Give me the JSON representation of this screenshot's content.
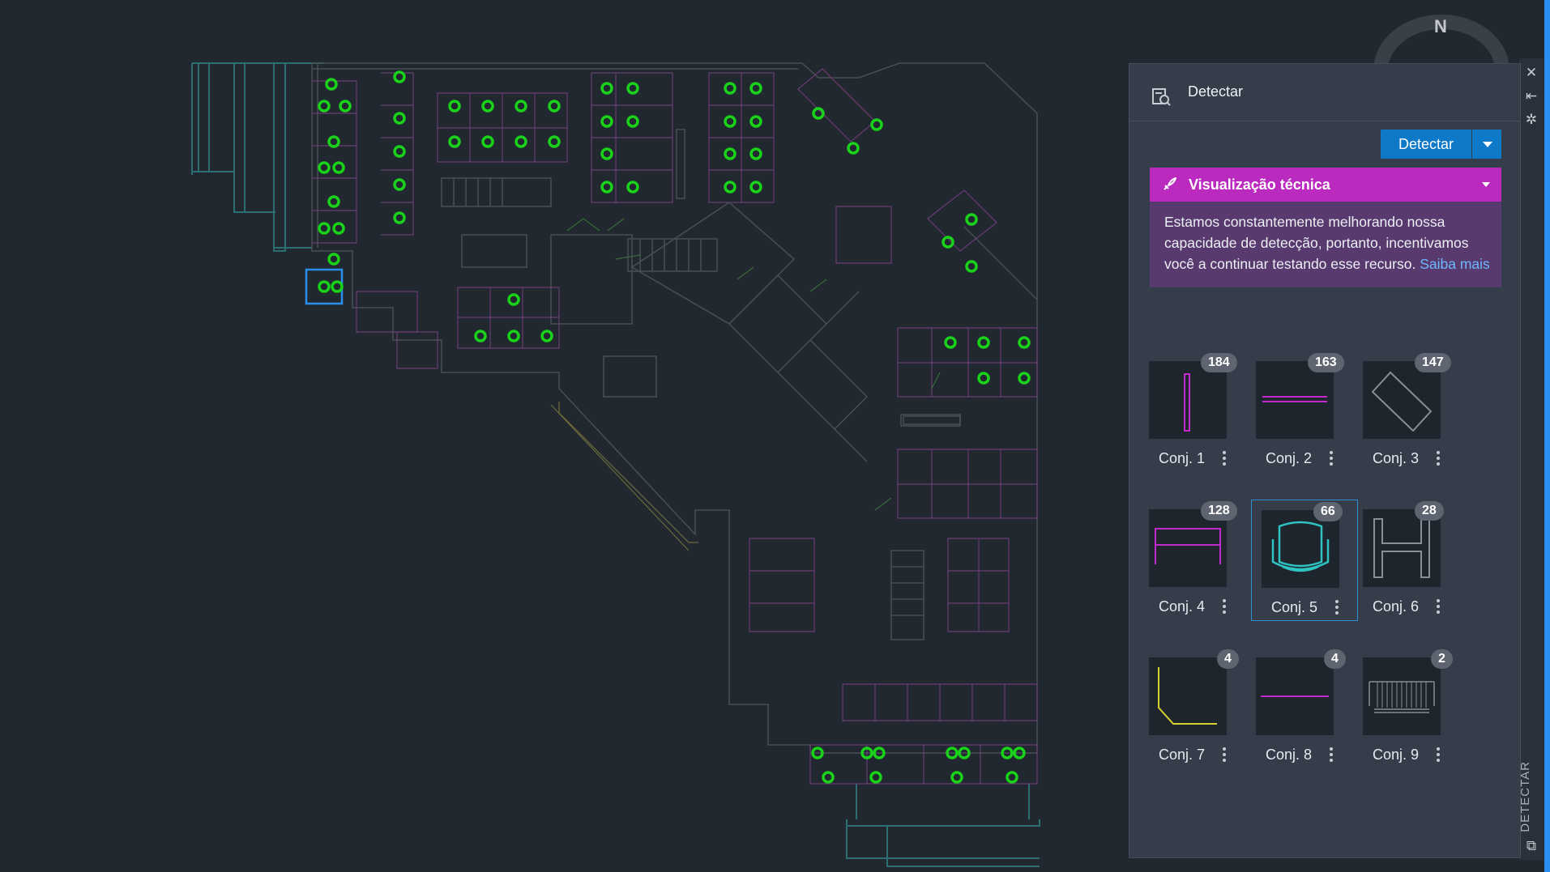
{
  "compass": {
    "label": "N"
  },
  "panel": {
    "title": "Detectar",
    "detect_button": "Detectar",
    "preview": {
      "title": "Visualização técnica",
      "body": "Estamos constantemente melhorando nossa capacidade de detecção, portanto, incentivamos você a continuar testando esse recurso.",
      "link": "Saiba mais"
    },
    "sets": [
      {
        "label": "Conj. 1",
        "count": "184",
        "icon": "vertical-line-magenta-icon"
      },
      {
        "label": "Conj. 2",
        "count": "163",
        "icon": "double-horizontal-line-magenta-icon"
      },
      {
        "label": "Conj. 3",
        "count": "147",
        "icon": "diamond-rectangle-gray-icon"
      },
      {
        "label": "Conj. 4",
        "count": "128",
        "icon": "table-frame-magenta-icon"
      },
      {
        "label": "Conj. 5",
        "count": "66",
        "icon": "chair-cyan-icon",
        "selected": true
      },
      {
        "label": "Conj. 6",
        "count": "28",
        "icon": "h-shape-gray-icon"
      },
      {
        "label": "Conj. 7",
        "count": "4",
        "icon": "corner-line-yellow-icon"
      },
      {
        "label": "Conj. 8",
        "count": "4",
        "icon": "horizontal-line-magenta-icon"
      },
      {
        "label": "Conj. 9",
        "count": "2",
        "icon": "stair-gray-icon"
      }
    ]
  },
  "side_strip": {
    "label": "DETECTAR"
  },
  "colors": {
    "background": "#212830",
    "panel": "#363d4a",
    "accent_blue": "#0e79c9",
    "preview_magenta": "#bb2abf",
    "preview_body": "#583a6e",
    "chair_green": "#19d219"
  }
}
